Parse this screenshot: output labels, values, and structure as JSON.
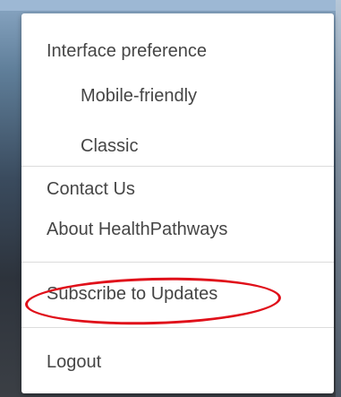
{
  "menu": {
    "items": [
      {
        "label": "Interface preference"
      },
      {
        "label": "Mobile-friendly"
      },
      {
        "label": "Classic"
      },
      {
        "label": "Contact Us"
      },
      {
        "label": "About HealthPathways"
      },
      {
        "label": "Subscribe to Updates"
      },
      {
        "label": "Logout"
      }
    ]
  },
  "colors": {
    "menu_text": "#454545",
    "highlight": "#e0101a",
    "divider": "#dcdcdc"
  }
}
